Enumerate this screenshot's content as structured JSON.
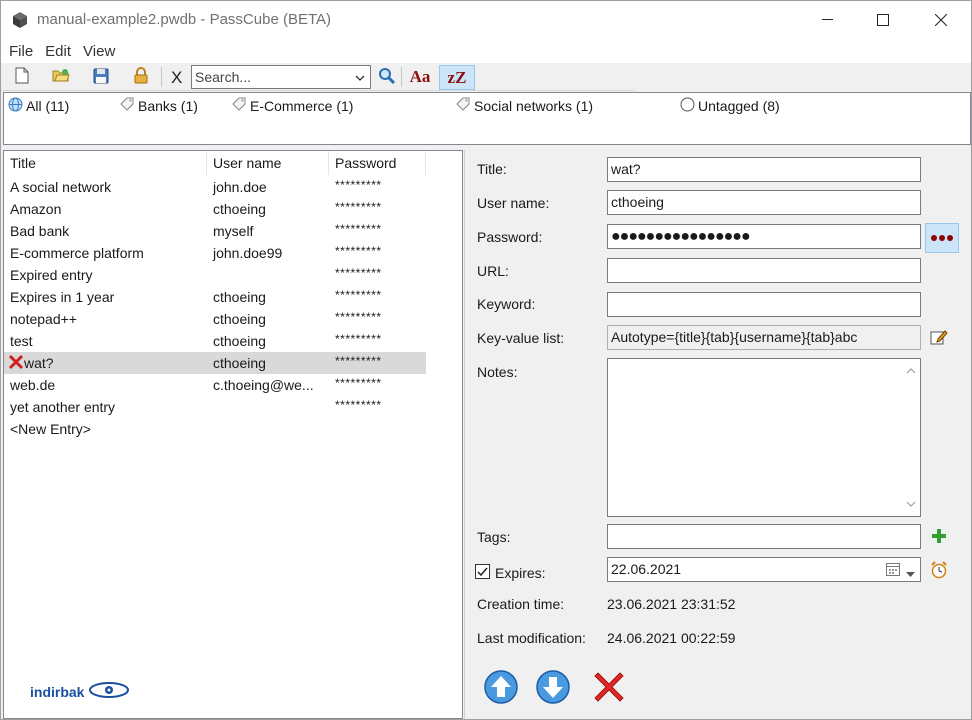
{
  "window": {
    "title": "manual-example2.pwdb - PassCube (BETA)"
  },
  "menu": [
    "File",
    "Edit",
    "View"
  ],
  "toolbar": {
    "clear_label": "X",
    "search_placeholder": "Search...",
    "case_label": "Aa",
    "sort_label": "zZ"
  },
  "tags": [
    {
      "label": "All (11)",
      "icon": "globe-icon"
    },
    {
      "label": "Banks (1)",
      "icon": "tag-icon"
    },
    {
      "label": "E-Commerce (1)",
      "icon": "tag-icon"
    },
    {
      "label": "Social networks (1)",
      "icon": "tag-icon"
    },
    {
      "label": "Untagged (8)",
      "icon": "circle-icon"
    }
  ],
  "list": {
    "headers": {
      "title": "Title",
      "user": "User name",
      "password": "Password"
    },
    "rows": [
      {
        "title": "A social network",
        "user": "john.doe",
        "password": "*********"
      },
      {
        "title": "Amazon",
        "user": "cthoeing",
        "password": "*********"
      },
      {
        "title": "Bad bank",
        "user": "myself",
        "password": "*********"
      },
      {
        "title": "E-commerce platform",
        "user": "john.doe99",
        "password": "*********"
      },
      {
        "title": "Expired entry",
        "user": "",
        "password": "*********"
      },
      {
        "title": "Expires in 1 year",
        "user": "cthoeing",
        "password": "*********"
      },
      {
        "title": "notepad++",
        "user": "cthoeing",
        "password": "*********"
      },
      {
        "title": "test",
        "user": "cthoeing",
        "password": "*********"
      },
      {
        "title": "wat?",
        "user": "cthoeing",
        "password": "*********"
      },
      {
        "title": "web.de",
        "user": "c.thoeing@we...",
        "password": "*********"
      },
      {
        "title": "yet another entry",
        "user": "",
        "password": "*********"
      },
      {
        "title": "<New Entry>",
        "user": "",
        "password": ""
      }
    ],
    "logo_text": "indirbak"
  },
  "detail": {
    "labels": {
      "title": "Title:",
      "user": "User name:",
      "password": "Password:",
      "url": "URL:",
      "keyword": "Keyword:",
      "kv": "Key-value list:",
      "notes": "Notes:",
      "tags": "Tags:",
      "expires": "Expires:",
      "created": "Creation time:",
      "modified": "Last modification:"
    },
    "values": {
      "title": "wat?",
      "user": "cthoeing",
      "password": "●●●●●●●●●●●●●●●●",
      "url": "",
      "keyword": "",
      "kv": "Autotype={title}{tab}{username}{tab}abc",
      "notes": "",
      "tags": "",
      "expires": "22.06.2021",
      "created": "23.06.2021 23:31:52",
      "modified": "24.06.2021 00:22:59"
    }
  },
  "colors": {
    "accent_bg": "#cce4f7",
    "accent_border": "#99c8ee",
    "selection": "#d9d9d9",
    "dark_red": "#8b1010"
  }
}
